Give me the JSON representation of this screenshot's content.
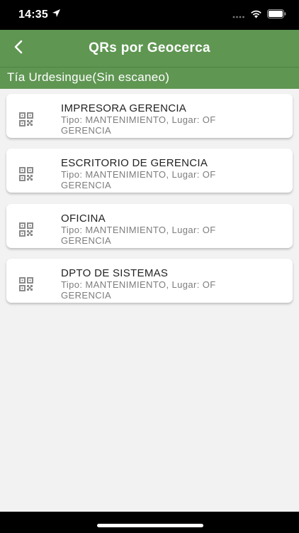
{
  "status_bar": {
    "time": "14:35",
    "icons": [
      "location-arrow-icon",
      "signal-icon",
      "wifi-icon",
      "battery-icon"
    ]
  },
  "header": {
    "title": "QRs por Geocerca",
    "back_icon": "chevron-left-icon",
    "color": "#5f9652"
  },
  "subheader": {
    "text": "Tía Urdesingue(Sin escaneo)"
  },
  "items": [
    {
      "title": "IMPRESORA GERENCIA",
      "subtitle": "Tipo: MANTENIMIENTO, Lugar: OF GERENCIA",
      "icon": "qr-code-icon"
    },
    {
      "title": "ESCRITORIO DE GERENCIA",
      "subtitle": "Tipo: MANTENIMIENTO, Lugar: OF GERENCIA",
      "icon": "qr-code-icon"
    },
    {
      "title": "OFICINA",
      "subtitle": "Tipo: MANTENIMIENTO, Lugar: OF GERENCIA",
      "icon": "qr-code-icon"
    },
    {
      "title": "DPTO DE SISTEMAS",
      "subtitle": "Tipo: MANTENIMIENTO, Lugar: OF GERENCIA",
      "icon": "qr-code-icon"
    }
  ]
}
